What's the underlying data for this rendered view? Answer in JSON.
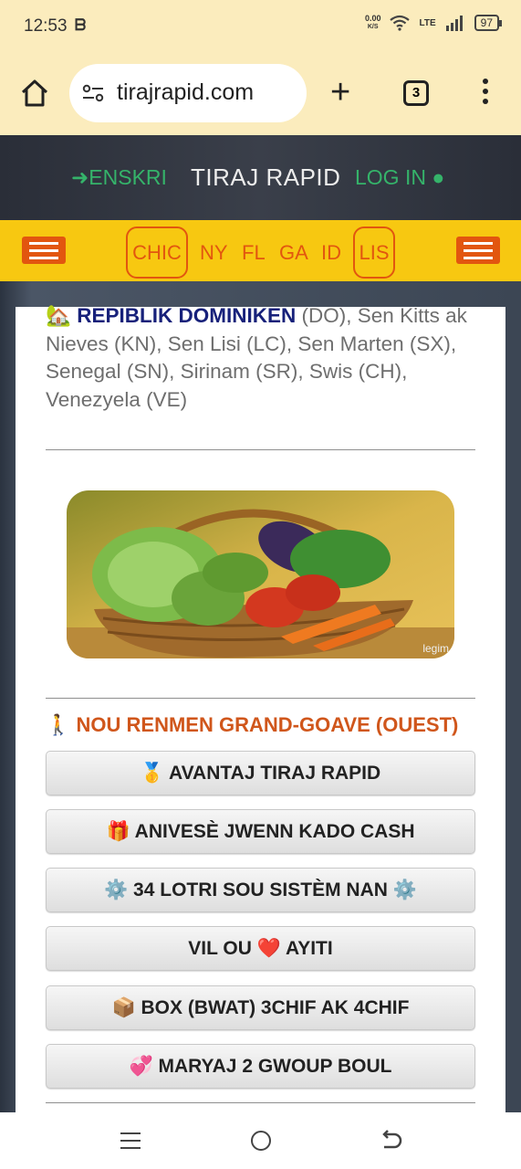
{
  "status_bar": {
    "time": "12:53",
    "notif": "ᗷ",
    "net_speed": "0.00",
    "net_unit": "K/S",
    "lte": "LTE",
    "battery": "97"
  },
  "browser": {
    "url": "tirajrapid.com",
    "tab_count": "3"
  },
  "header": {
    "signup": "ENSKRI",
    "brand": "TIRAJ RAPID",
    "login": "LOG IN"
  },
  "nav": {
    "items": [
      "CHIC",
      "NY",
      "FL",
      "GA",
      "ID",
      "LIS"
    ]
  },
  "countries": {
    "dom_emoji": "🏡",
    "dom_name": "REPIBLIK DOMINIKEN",
    "rest": " (DO), Sen Kitts ak Nieves (KN), Sen Lisi (LC), Sen Marten (SX), Senegal (SN), Sirinam (SR), Swis (CH), Venezyela (VE)"
  },
  "image": {
    "watermark": "legim"
  },
  "section": {
    "icon": "🚶",
    "title": "NOU RENMEN GRAND-GOAVE (OUEST)"
  },
  "buttons": [
    "🥇 AVANTAJ TIRAJ RAPID",
    "🎁 ANIVESÈ JWENN KADO CASH",
    "⚙️ 34 LOTRI SOU SISTÈM NAN ⚙️",
    "VIL OU ❤️ AYITI",
    "📦 BOX (BWAT) 3CHIF AK 4CHIF",
    "💞 MARYAJ 2 GWOUP BOUL"
  ],
  "colors": {
    "accent_orange": "#e2560f",
    "nav_yellow": "#f7c811",
    "green": "#35b36a",
    "browser_bg": "#fbecbd"
  }
}
